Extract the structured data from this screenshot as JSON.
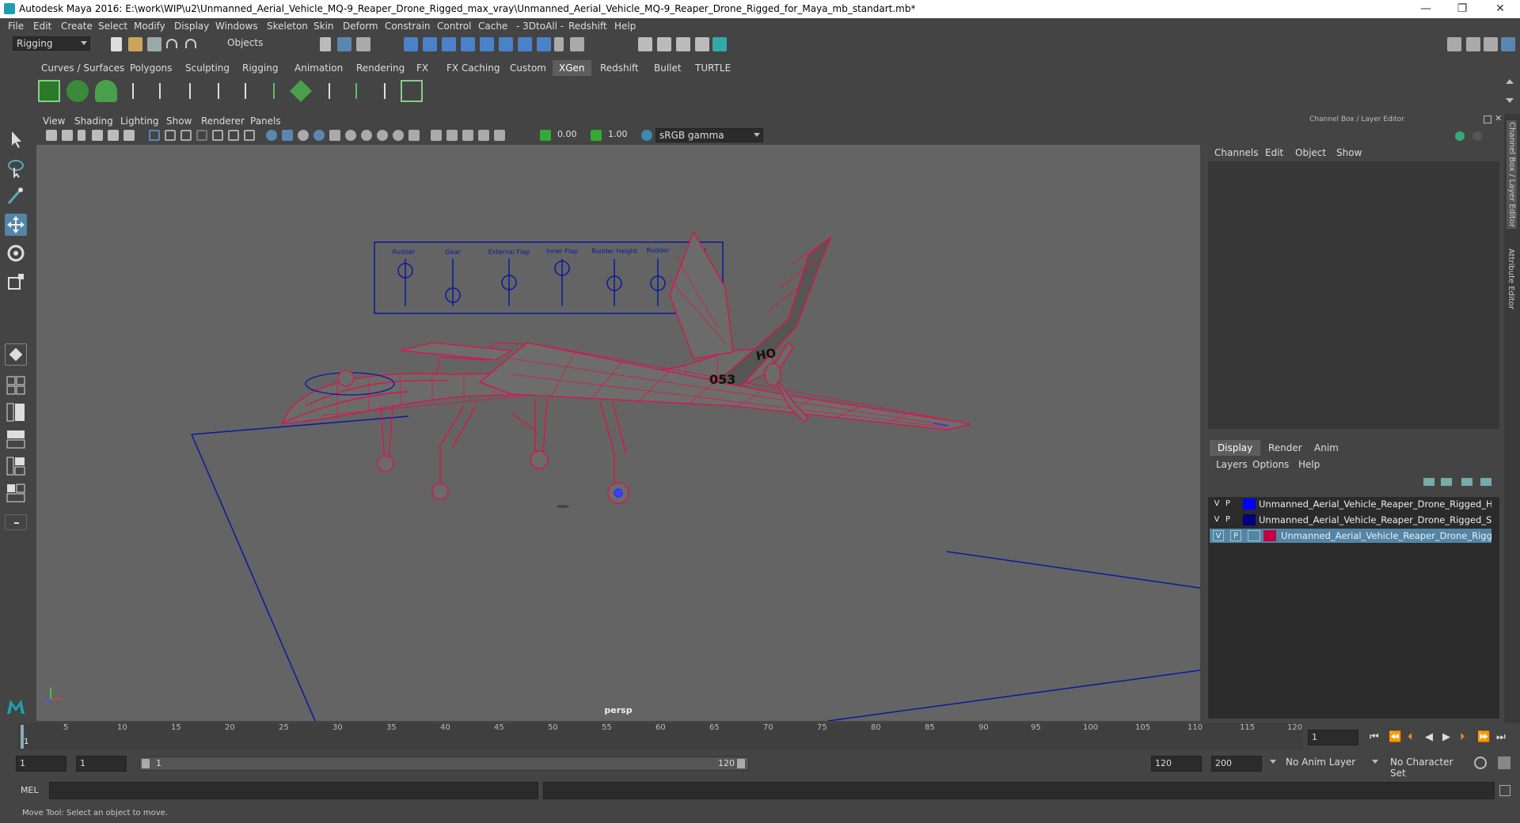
{
  "window": {
    "title": "Autodesk Maya 2016: E:\\work\\WIP\\u2\\Unmanned_Aerial_Vehicle_MQ-9_Reaper_Drone_Rigged_max_vray\\Unmanned_Aerial_Vehicle_MQ-9_Reaper_Drone_Rigged_for_Maya_mb_standart.mb*",
    "minimize": "—",
    "maximize": "❐",
    "close": "✕"
  },
  "menubar": [
    "File",
    "Edit",
    "Create",
    "Select",
    "Modify",
    "Display",
    "Windows",
    "Skeleton",
    "Skin",
    "Deform",
    "Constrain",
    "Control",
    "Cache",
    "- 3DtoAll -",
    "Redshift",
    "Help"
  ],
  "statusline": {
    "menuset": "Rigging",
    "selection_mode": "Objects"
  },
  "shelf_tabs": [
    "Curves / Surfaces",
    "Polygons",
    "Sculpting",
    "Rigging",
    "Animation",
    "Rendering",
    "FX",
    "FX Caching",
    "Custom",
    "XGen",
    "Redshift",
    "Bullet",
    "TURTLE"
  ],
  "shelf_active_tab": "XGen",
  "viewport": {
    "menu": [
      "View",
      "Shading",
      "Lighting",
      "Show",
      "Renderer",
      "Panels"
    ],
    "exposure": "0.00",
    "gamma": "1.00",
    "colorspace": "sRGB gamma",
    "camera": "persp",
    "rig_panel_labels": [
      "Rudder",
      "Gear",
      "External Flap",
      "Inner Flap",
      "Rudder Height",
      "Rudder",
      "Rotor"
    ],
    "tail_number": "053",
    "tail_code": "HO"
  },
  "right_panel": {
    "title": "Channel Box / Layer Editor",
    "channel_menu": [
      "Channels",
      "Edit",
      "Object",
      "Show"
    ],
    "layer_tabs": [
      "Display",
      "Render",
      "Anim"
    ],
    "layer_active_tab": "Display",
    "layer_menu": [
      "Layers",
      "Options",
      "Help"
    ],
    "layers": [
      {
        "v": "V",
        "p": "P",
        "name": "Unmanned_Aerial_Vehicle_Reaper_Drone_Rigged_Helpe",
        "color": "#0000ff",
        "selected": false
      },
      {
        "v": "V",
        "p": "P",
        "name": "Unmanned_Aerial_Vehicle_Reaper_Drone_Rigged_Slider",
        "color": "#000080",
        "selected": false
      },
      {
        "v": "V",
        "p": "P",
        "name": "Unmanned_Aerial_Vehicle_Reaper_Drone_Rigged",
        "color": "#c00040",
        "selected": true
      }
    ],
    "side_tabs": [
      "Channel Box / Layer Editor",
      "Attribute Editor"
    ]
  },
  "timeline": {
    "ticks": [
      "5",
      "10",
      "15",
      "20",
      "25",
      "30",
      "35",
      "40",
      "45",
      "50",
      "55",
      "60",
      "65",
      "70",
      "75",
      "80",
      "85",
      "90",
      "95",
      "100",
      "105",
      "110",
      "115",
      "120"
    ],
    "start_tick": "1",
    "current_frame": "1"
  },
  "range": {
    "start": "1",
    "playback_start": "1",
    "slider_start": "1",
    "slider_end": "120",
    "playback_end": "120",
    "end": "200",
    "anim_layer": "No Anim Layer",
    "character_set": "No Character Set"
  },
  "cmdline": {
    "label": "MEL"
  },
  "helpline": {
    "text": "Move Tool: Select an object to move."
  },
  "colors": {
    "wire": "#e0104a",
    "selection": "#5285a6",
    "helper": "#00008b"
  }
}
